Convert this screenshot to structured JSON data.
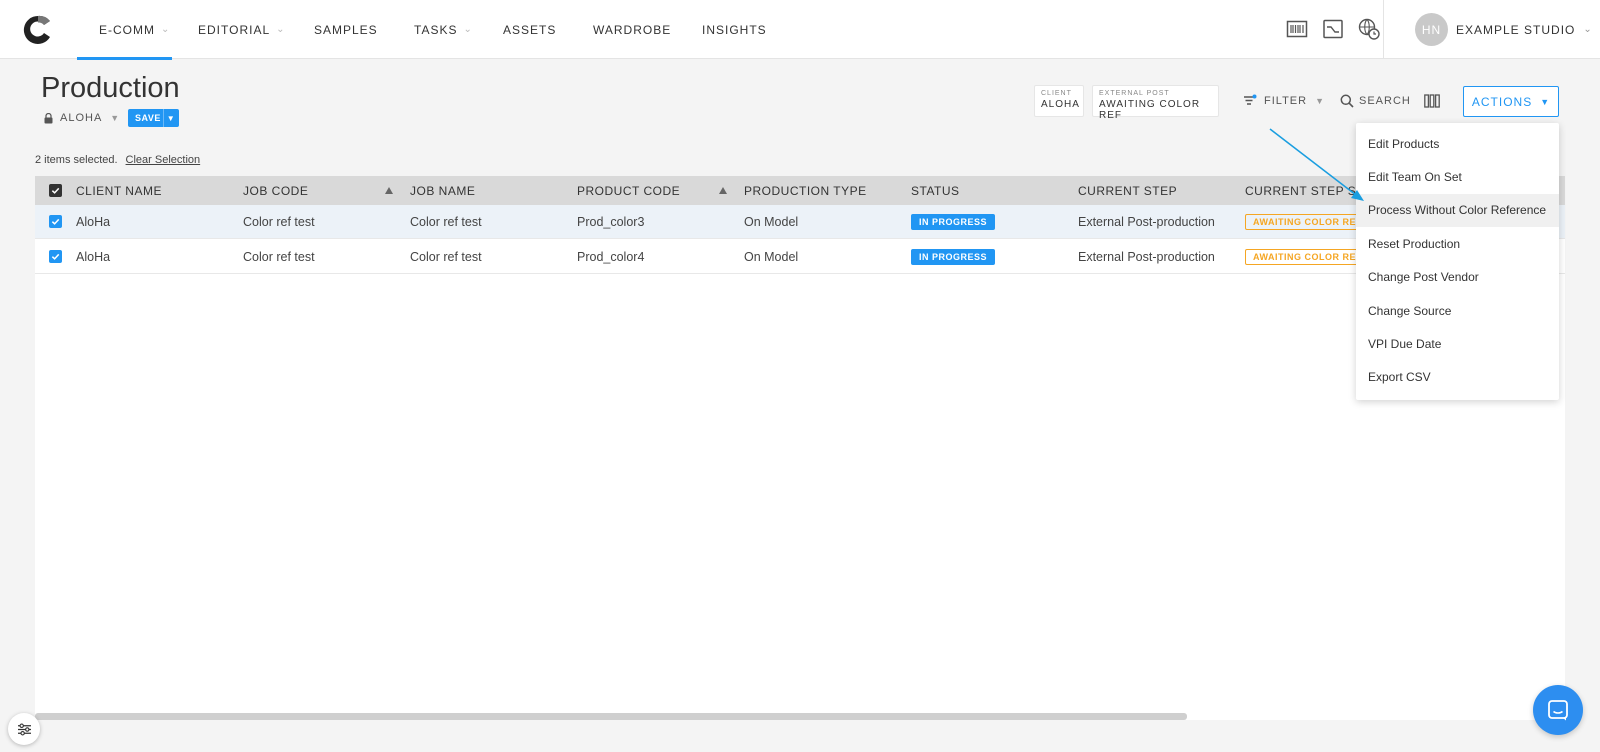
{
  "nav": {
    "items": [
      {
        "label": "E-COMM",
        "dropdown": true,
        "active": true
      },
      {
        "label": "EDITORIAL",
        "dropdown": true
      },
      {
        "label": "SAMPLES",
        "dropdown": false
      },
      {
        "label": "TASKS",
        "dropdown": true
      },
      {
        "label": "ASSETS",
        "dropdown": false
      },
      {
        "label": "WARDROBE",
        "dropdown": false
      },
      {
        "label": "INSIGHTS",
        "dropdown": false
      }
    ],
    "icons": [
      "barcode-icon",
      "chart-window-icon",
      "globe-clock-icon"
    ],
    "user": {
      "initials": "HN",
      "studio": "EXAMPLE STUDIO"
    }
  },
  "page": {
    "title": "Production",
    "view_name": "ALOHA",
    "save_label": "SAVE"
  },
  "chips": [
    {
      "key": "CLIENT",
      "value": "ALOHA"
    },
    {
      "key": "EXTERNAL POST",
      "value": "AWAITING COLOR REF"
    }
  ],
  "toolbar": {
    "filter_label": "FILTER",
    "search_label": "SEARCH",
    "actions_label": "ACTIONS"
  },
  "selection": {
    "text": "2 items selected.",
    "clear_label": "Clear Selection"
  },
  "table": {
    "columns": [
      "CLIENT NAME",
      "JOB CODE",
      "JOB NAME",
      "PRODUCT CODE",
      "PRODUCTION TYPE",
      "STATUS",
      "CURRENT STEP",
      "CURRENT STEP STA"
    ],
    "rows": [
      {
        "client": "AloHa",
        "job_code": "Color ref test",
        "job_name": "Color ref test",
        "product_code": "Prod_color3",
        "production_type": "On Model",
        "status": "IN PROGRESS",
        "current_step": "External Post-production",
        "step_status": "AWAITING COLOR REF"
      },
      {
        "client": "AloHa",
        "job_code": "Color ref test",
        "job_name": "Color ref test",
        "product_code": "Prod_color4",
        "production_type": "On Model",
        "status": "IN PROGRESS",
        "current_step": "External Post-production",
        "step_status": "AWAITING COLOR REF"
      }
    ]
  },
  "actions_menu": {
    "items": [
      "Edit Products",
      "Edit Team On Set",
      "Process Without Color Reference",
      "Reset Production",
      "Change Post Vendor",
      "Change Source",
      "VPI Due Date",
      "Export CSV"
    ],
    "highlighted_index": 2
  },
  "colors": {
    "accent": "#2196f3",
    "warning": "#f5a623",
    "annotation_arrow": "#1a9ee0"
  }
}
